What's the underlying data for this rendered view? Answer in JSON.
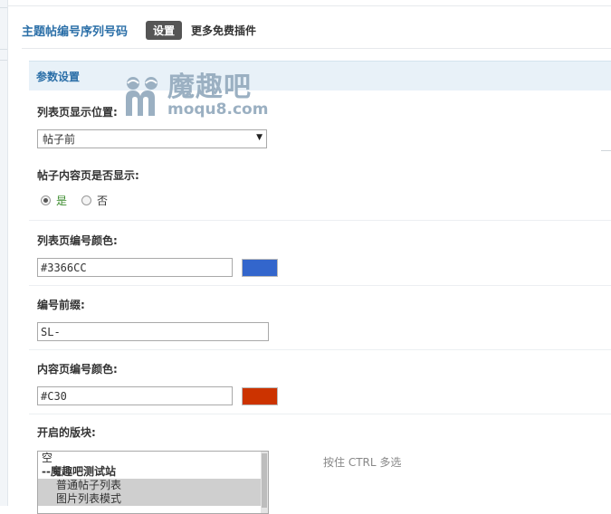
{
  "header": {
    "plugin_title": "主题帖编号序列号码",
    "tab_active": "设置",
    "tab_more": "更多免费插件"
  },
  "section": {
    "title": "参数设置"
  },
  "watermark": {
    "brand": "魔趣吧",
    "domain": "moqu8.com"
  },
  "fields": {
    "list_position": {
      "label": "列表页显示位置:",
      "selected": "帖子前"
    },
    "content_display": {
      "label": "帖子内容页是否显示:",
      "options": [
        "是",
        "否"
      ],
      "selected": "是"
    },
    "list_color": {
      "label": "列表页编号颜色:",
      "value": "#3366CC",
      "swatch": "#3366cc"
    },
    "prefix": {
      "label": "编号前缀:",
      "value": "SL-"
    },
    "content_color": {
      "label": "内容页编号颜色:",
      "value": "#C30",
      "swatch": "#cc3300"
    },
    "forums": {
      "label": "开启的版块:",
      "items": [
        "空",
        "--魔趣吧测试站",
        "普通帖子列表",
        "图片列表模式"
      ],
      "hint": "按住 CTRL 多选"
    }
  }
}
